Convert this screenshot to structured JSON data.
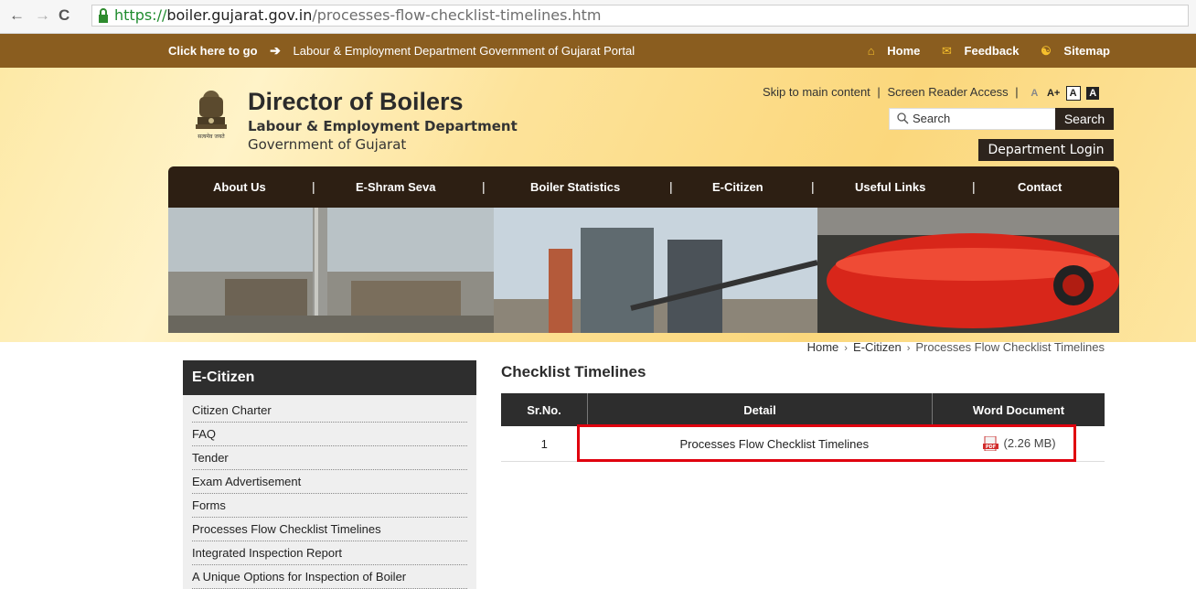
{
  "browser": {
    "url_protocol": "https://",
    "url_host": "boiler.gujarat.gov.in",
    "url_path": "/processes-flow-checklist-timelines.htm"
  },
  "topbar": {
    "click_here": "Click here to go",
    "portal_link": "Labour & Employment Department Government of Gujarat Portal",
    "home": "Home",
    "feedback": "Feedback",
    "sitemap": "Sitemap"
  },
  "header": {
    "title": "Director of Boilers",
    "subtitle1": "Labour & Employment Department",
    "subtitle2": "Government of Gujarat",
    "emblem_motto": "सत्यमेव जयते",
    "skip": "Skip to main content",
    "screen_reader": "Screen Reader Access",
    "font_small": "A",
    "font_large": "A+",
    "contrast_light": "A",
    "contrast_dark": "A",
    "search_placeholder": "Search",
    "search_button": "Search",
    "dept_login": "Department Login"
  },
  "nav": {
    "items": [
      "About Us",
      "E-Shram Seva",
      "Boiler Statistics",
      "E-Citizen",
      "Useful Links",
      "Contact"
    ]
  },
  "breadcrumb": {
    "home": "Home",
    "section": "E-Citizen",
    "current": "Processes Flow Checklist Timelines"
  },
  "sidebar": {
    "heading": "E-Citizen",
    "items": [
      "Citizen Charter",
      "FAQ",
      "Tender",
      "Exam Advertisement",
      "Forms",
      "Processes Flow Checklist Timelines",
      "Integrated Inspection Report",
      "A Unique Options for Inspection of Boiler"
    ]
  },
  "main": {
    "title": "Checklist Timelines",
    "columns": [
      "Sr.No.",
      "Detail",
      "Word Document"
    ],
    "rows": [
      {
        "sr": "1",
        "detail": "Processes Flow Checklist Timelines",
        "size": "(2.26 MB)"
      }
    ]
  },
  "colors": {
    "top_strip": "#8a5d1f",
    "nav_bg": "#2d1f13",
    "highlight": "#e0000e"
  }
}
